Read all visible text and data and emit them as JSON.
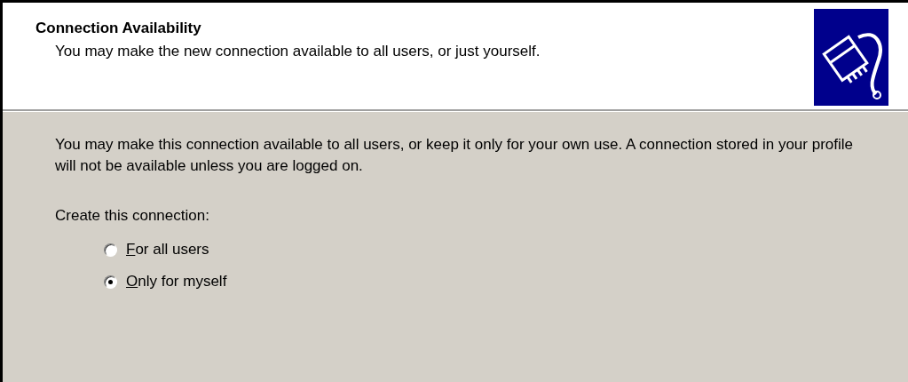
{
  "header": {
    "title": "Connection Availability",
    "subtitle": "You may make the new connection available to all users, or just yourself."
  },
  "body": {
    "description": "You may make this connection available to all users, or keep it only for your own use.  A connection stored in your profile will not be available unless you are logged on.",
    "prompt": "Create this connection:",
    "options": [
      {
        "label": "For all users",
        "selected": false
      },
      {
        "label": "Only for myself",
        "selected": true
      }
    ]
  }
}
